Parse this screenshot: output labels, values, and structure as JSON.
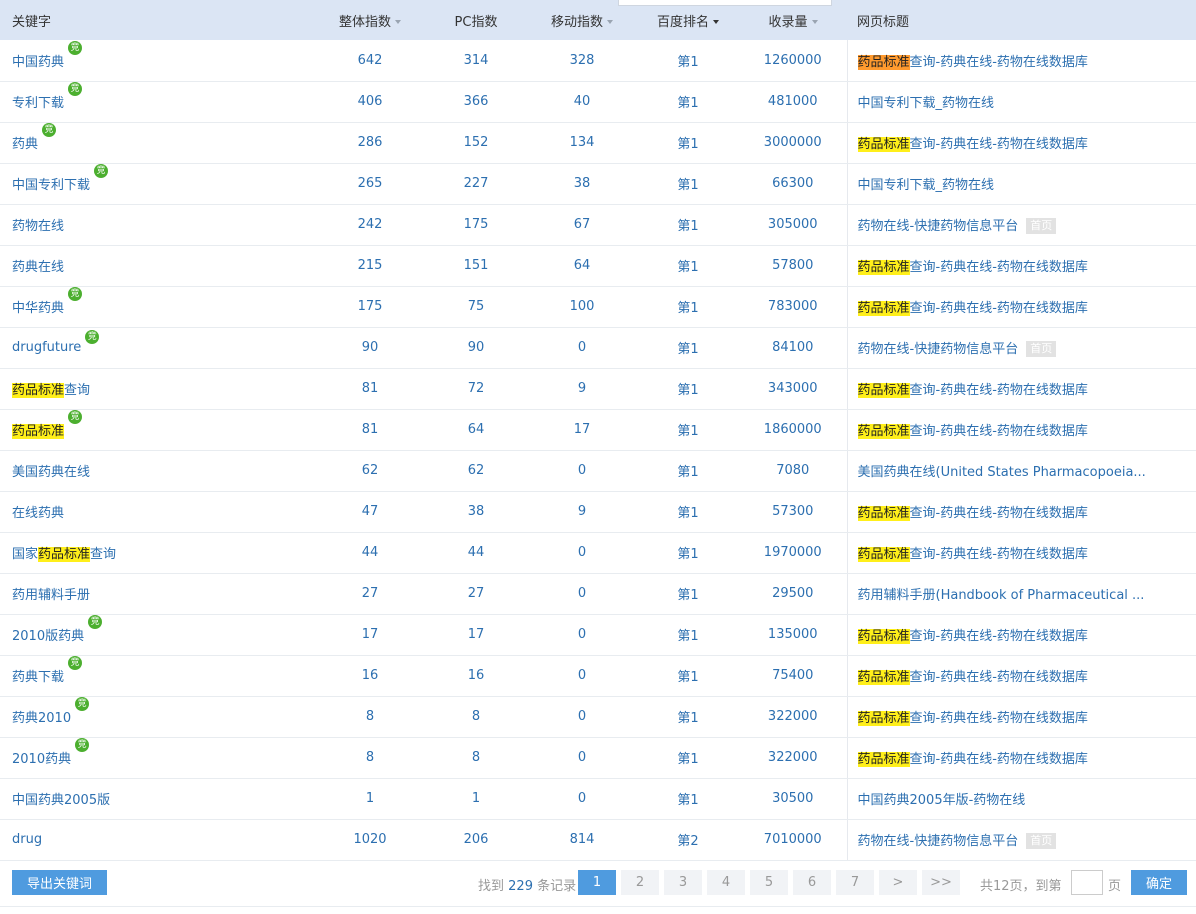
{
  "header": {
    "keyword": "关键字",
    "overall_index": "整体指数",
    "pc_index": "PC指数",
    "mobile_index": "移动指数",
    "baidu_rank": "百度排名",
    "indexed": "收录量",
    "page_title": "网页标题"
  },
  "badge_label": "竞",
  "home_tag": "首页",
  "highlight_term": "药品标准",
  "rows": [
    {
      "kw_parts": [
        {
          "t": "中国药典",
          "h": false
        }
      ],
      "jing": true,
      "overall": "642",
      "pc": "314",
      "mobile": "328",
      "rank": "第1",
      "indexed": "1260000",
      "title_parts": [
        {
          "t": "药品标准",
          "h": true,
          "o": true
        },
        {
          "t": "查询-药典在线-药物在线数据库",
          "h": false
        }
      ],
      "home": false
    },
    {
      "kw_parts": [
        {
          "t": "专利下载",
          "h": false
        }
      ],
      "jing": true,
      "overall": "406",
      "pc": "366",
      "mobile": "40",
      "rank": "第1",
      "indexed": "481000",
      "title_parts": [
        {
          "t": "中国专利下载_药物在线",
          "h": false
        }
      ],
      "home": false
    },
    {
      "kw_parts": [
        {
          "t": "药典",
          "h": false
        }
      ],
      "jing": true,
      "overall": "286",
      "pc": "152",
      "mobile": "134",
      "rank": "第1",
      "indexed": "3000000",
      "title_parts": [
        {
          "t": "药品标准",
          "h": true
        },
        {
          "t": "查询-药典在线-药物在线数据库",
          "h": false
        }
      ],
      "home": false
    },
    {
      "kw_parts": [
        {
          "t": "中国专利下载",
          "h": false
        }
      ],
      "jing": true,
      "overall": "265",
      "pc": "227",
      "mobile": "38",
      "rank": "第1",
      "indexed": "66300",
      "title_parts": [
        {
          "t": "中国专利下载_药物在线",
          "h": false
        }
      ],
      "home": false
    },
    {
      "kw_parts": [
        {
          "t": "药物在线",
          "h": false
        }
      ],
      "jing": false,
      "overall": "242",
      "pc": "175",
      "mobile": "67",
      "rank": "第1",
      "indexed": "305000",
      "title_parts": [
        {
          "t": "药物在线-快捷药物信息平台",
          "h": false
        }
      ],
      "home": true
    },
    {
      "kw_parts": [
        {
          "t": "药典在线",
          "h": false
        }
      ],
      "jing": false,
      "overall": "215",
      "pc": "151",
      "mobile": "64",
      "rank": "第1",
      "indexed": "57800",
      "title_parts": [
        {
          "t": "药品标准",
          "h": true
        },
        {
          "t": "查询-药典在线-药物在线数据库",
          "h": false
        }
      ],
      "home": false
    },
    {
      "kw_parts": [
        {
          "t": "中华药典",
          "h": false
        }
      ],
      "jing": true,
      "overall": "175",
      "pc": "75",
      "mobile": "100",
      "rank": "第1",
      "indexed": "783000",
      "title_parts": [
        {
          "t": "药品标准",
          "h": true
        },
        {
          "t": "查询-药典在线-药物在线数据库",
          "h": false
        }
      ],
      "home": false
    },
    {
      "kw_parts": [
        {
          "t": "drugfuture",
          "h": false
        }
      ],
      "jing": true,
      "overall": "90",
      "pc": "90",
      "mobile": "0",
      "rank": "第1",
      "indexed": "84100",
      "title_parts": [
        {
          "t": "药物在线-快捷药物信息平台",
          "h": false
        }
      ],
      "home": true
    },
    {
      "kw_parts": [
        {
          "t": "药品标准",
          "h": true
        },
        {
          "t": "查询",
          "h": false
        }
      ],
      "jing": false,
      "overall": "81",
      "pc": "72",
      "mobile": "9",
      "rank": "第1",
      "indexed": "343000",
      "title_parts": [
        {
          "t": "药品标准",
          "h": true
        },
        {
          "t": "查询-药典在线-药物在线数据库",
          "h": false
        }
      ],
      "home": false
    },
    {
      "kw_parts": [
        {
          "t": "药品标准",
          "h": true
        }
      ],
      "jing": true,
      "overall": "81",
      "pc": "64",
      "mobile": "17",
      "rank": "第1",
      "indexed": "1860000",
      "title_parts": [
        {
          "t": "药品标准",
          "h": true
        },
        {
          "t": "查询-药典在线-药物在线数据库",
          "h": false
        }
      ],
      "home": false
    },
    {
      "kw_parts": [
        {
          "t": "美国药典在线",
          "h": false
        }
      ],
      "jing": false,
      "overall": "62",
      "pc": "62",
      "mobile": "0",
      "rank": "第1",
      "indexed": "7080",
      "title_parts": [
        {
          "t": "美国药典在线(United States Pharmacopoeia...",
          "h": false
        }
      ],
      "home": false
    },
    {
      "kw_parts": [
        {
          "t": "在线药典",
          "h": false
        }
      ],
      "jing": false,
      "overall": "47",
      "pc": "38",
      "mobile": "9",
      "rank": "第1",
      "indexed": "57300",
      "title_parts": [
        {
          "t": "药品标准",
          "h": true
        },
        {
          "t": "查询-药典在线-药物在线数据库",
          "h": false
        }
      ],
      "home": false
    },
    {
      "kw_parts": [
        {
          "t": "国家",
          "h": false
        },
        {
          "t": "药品标准",
          "h": true
        },
        {
          "t": "查询",
          "h": false
        }
      ],
      "jing": false,
      "overall": "44",
      "pc": "44",
      "mobile": "0",
      "rank": "第1",
      "indexed": "1970000",
      "title_parts": [
        {
          "t": "药品标准",
          "h": true
        },
        {
          "t": "查询-药典在线-药物在线数据库",
          "h": false
        }
      ],
      "home": false
    },
    {
      "kw_parts": [
        {
          "t": "药用辅料手册",
          "h": false
        }
      ],
      "jing": false,
      "overall": "27",
      "pc": "27",
      "mobile": "0",
      "rank": "第1",
      "indexed": "29500",
      "title_parts": [
        {
          "t": "药用辅料手册(Handbook of Pharmaceutical ...",
          "h": false
        }
      ],
      "home": false
    },
    {
      "kw_parts": [
        {
          "t": "2010版药典",
          "h": false
        }
      ],
      "jing": true,
      "overall": "17",
      "pc": "17",
      "mobile": "0",
      "rank": "第1",
      "indexed": "135000",
      "title_parts": [
        {
          "t": "药品标准",
          "h": true
        },
        {
          "t": "查询-药典在线-药物在线数据库",
          "h": false
        }
      ],
      "home": false
    },
    {
      "kw_parts": [
        {
          "t": "药典下载",
          "h": false
        }
      ],
      "jing": true,
      "overall": "16",
      "pc": "16",
      "mobile": "0",
      "rank": "第1",
      "indexed": "75400",
      "title_parts": [
        {
          "t": "药品标准",
          "h": true
        },
        {
          "t": "查询-药典在线-药物在线数据库",
          "h": false
        }
      ],
      "home": false
    },
    {
      "kw_parts": [
        {
          "t": "药典2010",
          "h": false
        }
      ],
      "jing": true,
      "overall": "8",
      "pc": "8",
      "mobile": "0",
      "rank": "第1",
      "indexed": "322000",
      "title_parts": [
        {
          "t": "药品标准",
          "h": true
        },
        {
          "t": "查询-药典在线-药物在线数据库",
          "h": false
        }
      ],
      "home": false
    },
    {
      "kw_parts": [
        {
          "t": "2010药典",
          "h": false
        }
      ],
      "jing": true,
      "overall": "8",
      "pc": "8",
      "mobile": "0",
      "rank": "第1",
      "indexed": "322000",
      "title_parts": [
        {
          "t": "药品标准",
          "h": true
        },
        {
          "t": "查询-药典在线-药物在线数据库",
          "h": false
        }
      ],
      "home": false
    },
    {
      "kw_parts": [
        {
          "t": "中国药典2005版",
          "h": false
        }
      ],
      "jing": false,
      "overall": "1",
      "pc": "1",
      "mobile": "0",
      "rank": "第1",
      "indexed": "30500",
      "title_parts": [
        {
          "t": "中国药典2005年版-药物在线",
          "h": false
        }
      ],
      "home": false
    },
    {
      "kw_parts": [
        {
          "t": "drug",
          "h": false
        }
      ],
      "jing": false,
      "overall": "1020",
      "pc": "206",
      "mobile": "814",
      "rank": "第2",
      "indexed": "7010000",
      "title_parts": [
        {
          "t": "药物在线-快捷药物信息平台",
          "h": false
        }
      ],
      "home": true
    }
  ],
  "footer": {
    "export_label": "导出关键词",
    "found_prefix": "找到",
    "found_count": "229",
    "found_suffix": "条记录",
    "pages": [
      "1",
      "2",
      "3",
      "4",
      "5",
      "6",
      "7",
      ">",
      ">>"
    ],
    "current_page": "1",
    "total_text": "共12页，到第",
    "page_unit": "页",
    "confirm_label": "确定",
    "jump_value": ""
  }
}
